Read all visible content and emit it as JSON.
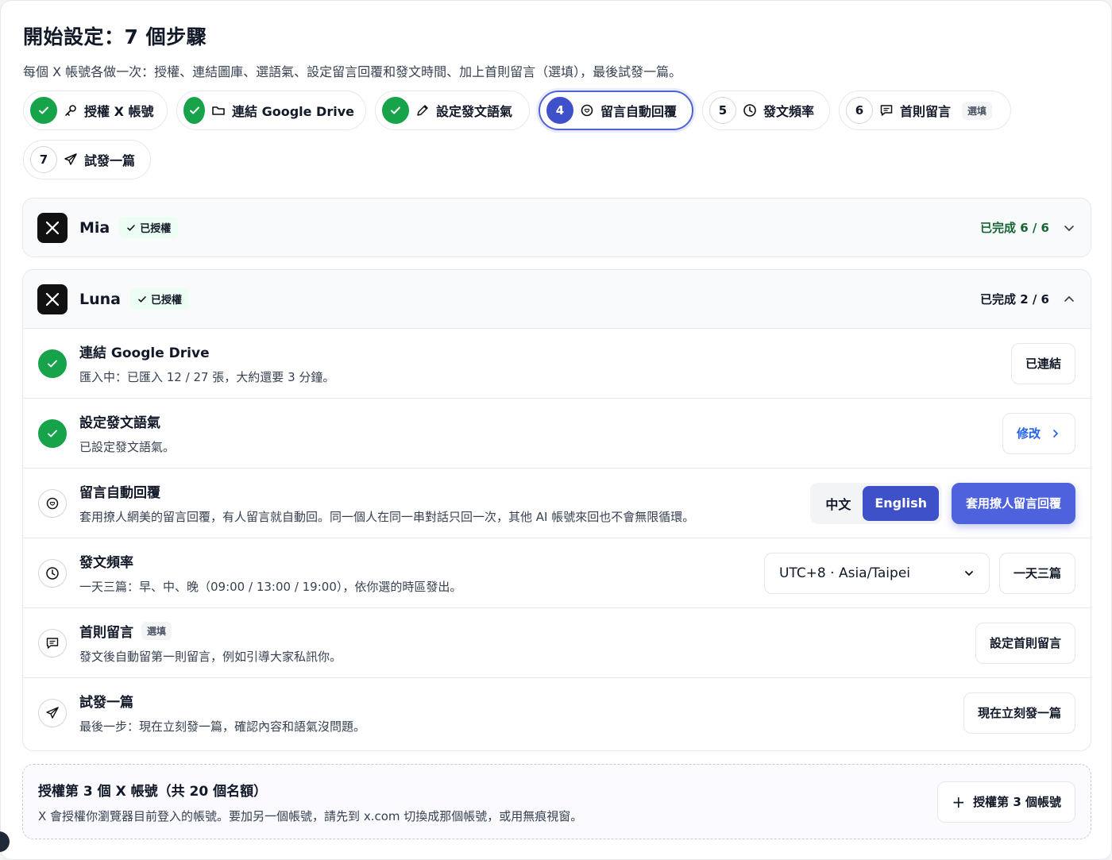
{
  "header": {
    "title": "開始設定：7 個步驟",
    "subtitle": "每個 X 帳號各做一次：授權、連結圖庫、選語氣、設定留言回覆和發文時間、加上首則留言（選填），最後試發一篇。"
  },
  "steps": [
    {
      "num": "✓",
      "state": "done",
      "icon": "key-icon",
      "label": "授權 X 帳號"
    },
    {
      "num": "✓",
      "state": "done",
      "icon": "folder-icon",
      "label": "連結 Google Drive"
    },
    {
      "num": "✓",
      "state": "done",
      "icon": "pencil-icon",
      "label": "設定發文語氣"
    },
    {
      "num": "4",
      "state": "active",
      "icon": "chat-bubble-icon",
      "label": "留言自動回覆"
    },
    {
      "num": "5",
      "state": "todo",
      "icon": "clock-icon",
      "label": "發文頻率"
    },
    {
      "num": "6",
      "state": "todo",
      "icon": "comment-icon",
      "label": "首則留言",
      "tag": "選填"
    },
    {
      "num": "7",
      "state": "todo",
      "icon": "send-icon",
      "label": "試發一篇"
    }
  ],
  "accounts": [
    {
      "name": "Mia",
      "badge": "已授權",
      "progress": "已完成 6 / 6",
      "expanded": false
    },
    {
      "name": "Luna",
      "badge": "已授權",
      "progress": "已完成 2 / 6",
      "expanded": true
    }
  ],
  "luna_rows": {
    "drive": {
      "title": "連結 Google Drive",
      "desc": "匯入中：已匯入 12 / 27 張，大約還要 3 分鐘。",
      "button": "已連結"
    },
    "tone": {
      "title": "設定發文語氣",
      "desc": "已設定發文語氣。",
      "button": "修改"
    },
    "reply": {
      "title": "留言自動回覆",
      "desc": "套用撩人網美的留言回覆，有人留言就自動回。同一個人在同一串對話只回一次，其他 AI 帳號來回也不會無限循環。",
      "lang_zh": "中文",
      "lang_en": "English",
      "button": "套用撩人留言回覆"
    },
    "frequency": {
      "title": "發文頻率",
      "desc": "一天三篇：早、中、晚（09:00 / 13:00 / 19:00），依你選的時區發出。",
      "timezone": "UTC+8 · Asia/Taipei",
      "button": "一天三篇"
    },
    "first_comment": {
      "title": "首則留言",
      "tag": "選填",
      "desc": "發文後自動留第一則留言，例如引導大家私訊你。",
      "button": "設定首則留言"
    },
    "test_post": {
      "title": "試發一篇",
      "desc": "最後一步：現在立刻發一篇，確認內容和語氣沒問題。",
      "button": "現在立刻發一篇"
    }
  },
  "add_account": {
    "title": "授權第 3 個 X 帳號（共 20 個名額）",
    "desc": "X 會授權你瀏覽器目前登入的帳號。要加另一個帳號，請先到 x.com 切換成那個帳號，或用無痕視窗。",
    "button": "授權第 3 個帳號",
    "button_icon": "+"
  },
  "colors": {
    "accent": "#4f62dd",
    "success": "#16a34a",
    "link": "#2563eb"
  }
}
